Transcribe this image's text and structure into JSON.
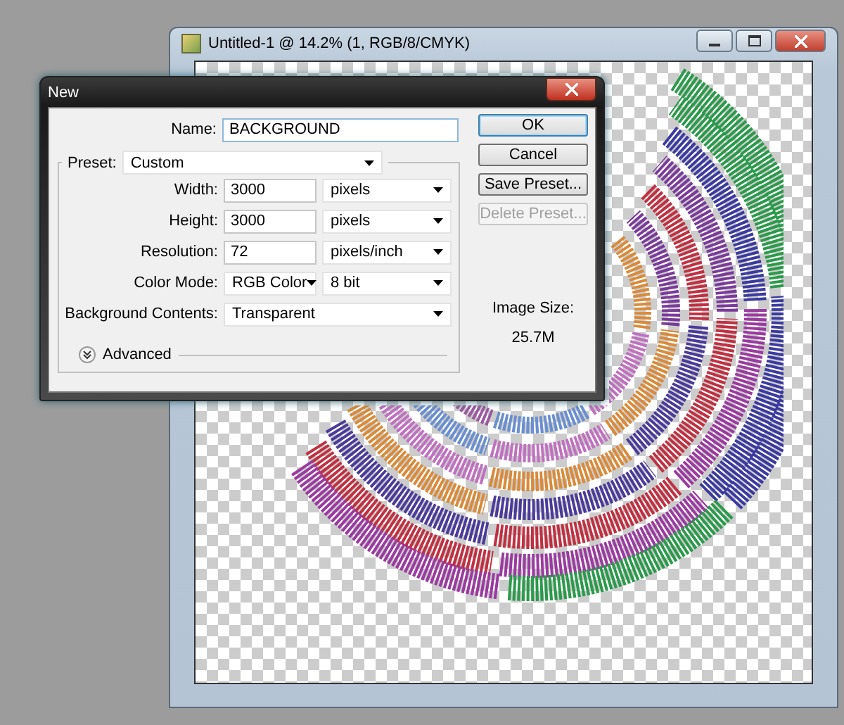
{
  "document_window": {
    "title": "Untitled-1 @ 14.2% (1, RGB/8/CMYK)"
  },
  "dialog": {
    "title": "New",
    "name": {
      "label": "Name:",
      "value": "BACKGROUND"
    },
    "preset": {
      "label": "Preset:",
      "value": "Custom"
    },
    "rows": [
      {
        "kind": "value-unit",
        "label": "Width:",
        "value": "3000",
        "unit": "pixels"
      },
      {
        "kind": "value-unit",
        "label": "Height:",
        "value": "3000",
        "unit": "pixels"
      },
      {
        "kind": "value-unit",
        "label": "Resolution:",
        "value": "72",
        "unit": "pixels/inch"
      },
      {
        "kind": "two-dropdowns",
        "label": "Color Mode:",
        "value": "RGB Color",
        "unit": "8 bit"
      },
      {
        "kind": "dropdown",
        "label": "Background Contents:",
        "value": "Transparent"
      }
    ],
    "advanced": {
      "label": "Advanced",
      "expanded": false
    },
    "buttons": [
      {
        "label": "OK",
        "default": true,
        "disabled": false
      },
      {
        "label": "Cancel",
        "default": false,
        "disabled": false
      },
      {
        "label": "Save Preset...",
        "default": false,
        "disabled": false
      },
      {
        "label": "Delete Preset...",
        "default": false,
        "disabled": true
      }
    ],
    "image_size": {
      "label": "Image Size:",
      "value": "25.7M"
    }
  }
}
